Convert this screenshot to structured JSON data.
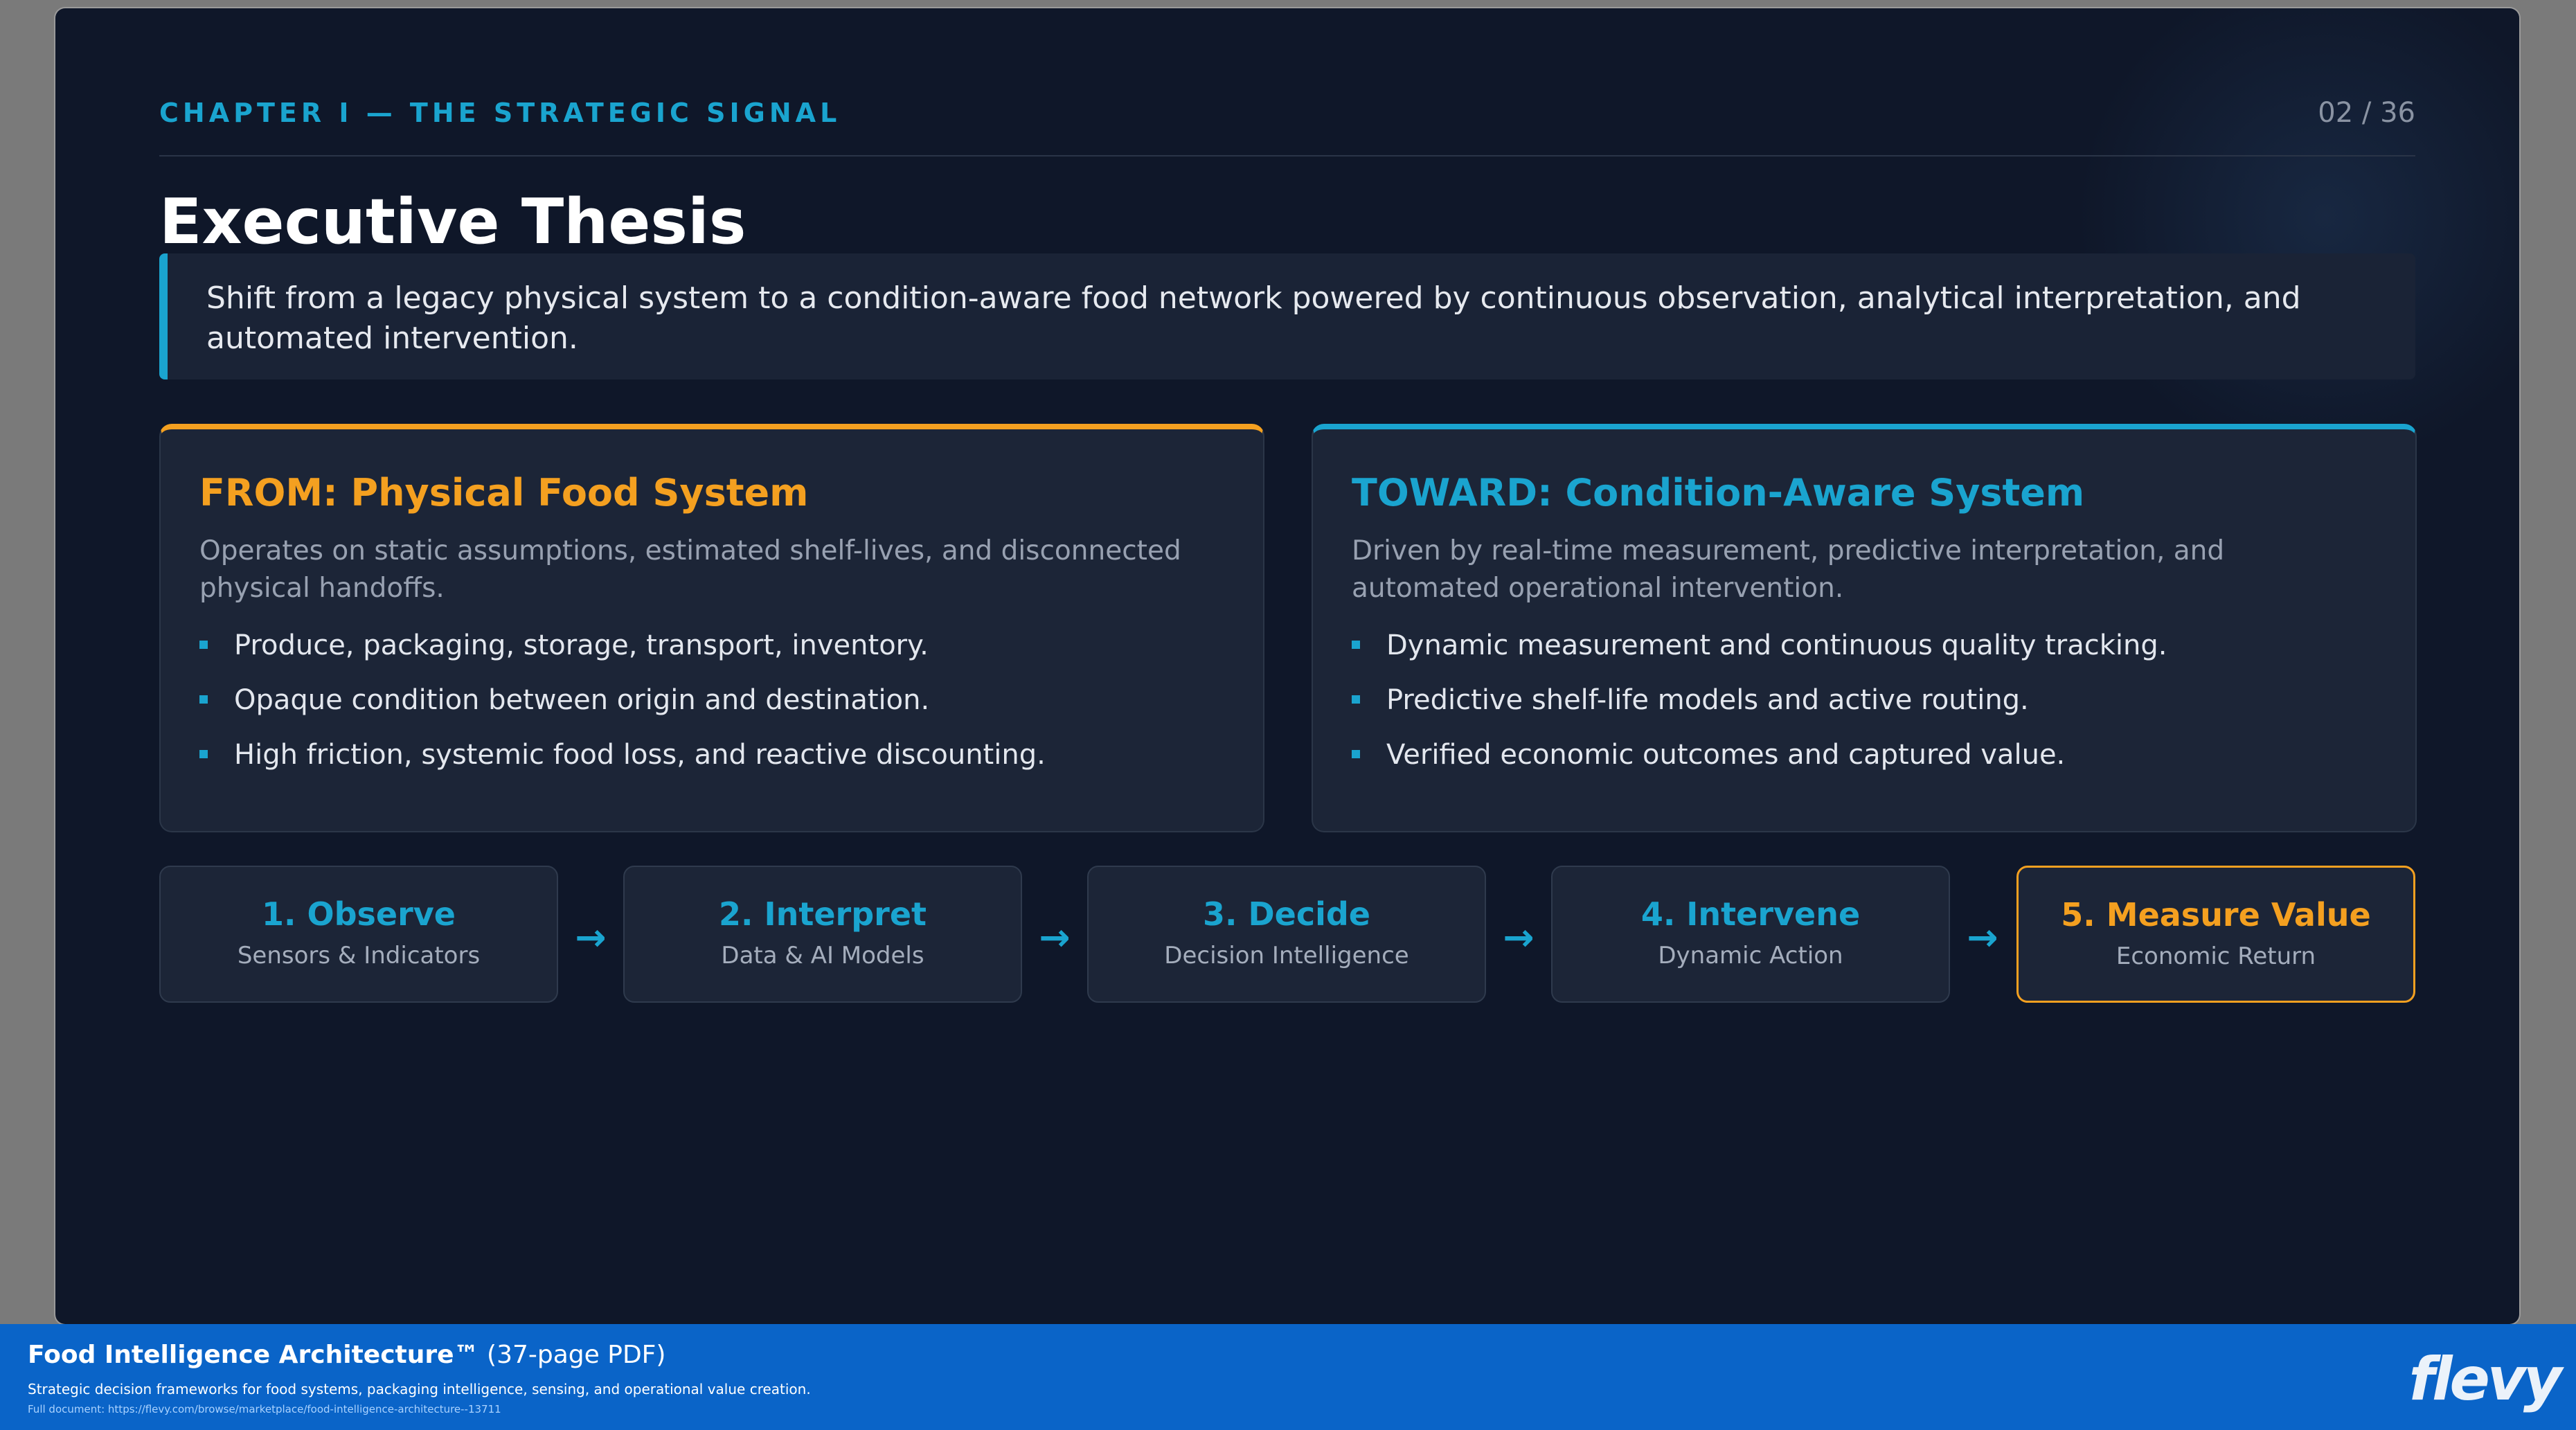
{
  "slide": {
    "chapter": "CHAPTER I — THE STRATEGIC SIGNAL",
    "page_indicator": "02 / 36",
    "title": "Executive Thesis",
    "thesis": "Shift from a legacy physical system to a condition-aware food network powered by continuous observation, analytical interpretation, and automated intervention.",
    "from_card": {
      "title": "FROM: Physical Food System",
      "description": "Operates on static assumptions, estimated shelf-lives, and disconnected physical handoffs.",
      "bullets": [
        "Produce, packaging, storage, transport, inventory.",
        "Opaque condition between origin and destination.",
        "High friction, systemic food loss, and reactive discounting."
      ]
    },
    "toward_card": {
      "title": "TOWARD: Condition-Aware System",
      "description": "Driven by real-time measurement, predictive interpretation, and automated operational intervention.",
      "bullets": [
        "Dynamic measurement and continuous quality tracking.",
        "Predictive shelf-life models and active routing.",
        "Verified economic outcomes and captured value."
      ]
    },
    "steps": [
      {
        "title": "1. Observe",
        "subtitle": "Sensors & Indicators"
      },
      {
        "title": "2. Interpret",
        "subtitle": "Data & AI Models"
      },
      {
        "title": "3. Decide",
        "subtitle": "Decision Intelligence"
      },
      {
        "title": "4. Intervene",
        "subtitle": "Dynamic Action"
      },
      {
        "title": "5. Measure Value",
        "subtitle": "Economic Return"
      }
    ],
    "arrow_glyph": "→"
  },
  "footer": {
    "title": "Food Intelligence Architecture™",
    "pages": "(37-page PDF)",
    "description": "Strategic decision frameworks for food systems, packaging intelligence, sensing, and operational value creation.",
    "url": "Full document: https://flevy.com/browse/marketplace/food-intelligence-architecture--13711",
    "logo": "flevy"
  },
  "colors": {
    "background": "#0f1729",
    "accent_cyan": "#1aa4cf",
    "accent_orange": "#f4a020",
    "footer_blue": "#0a64c8"
  }
}
